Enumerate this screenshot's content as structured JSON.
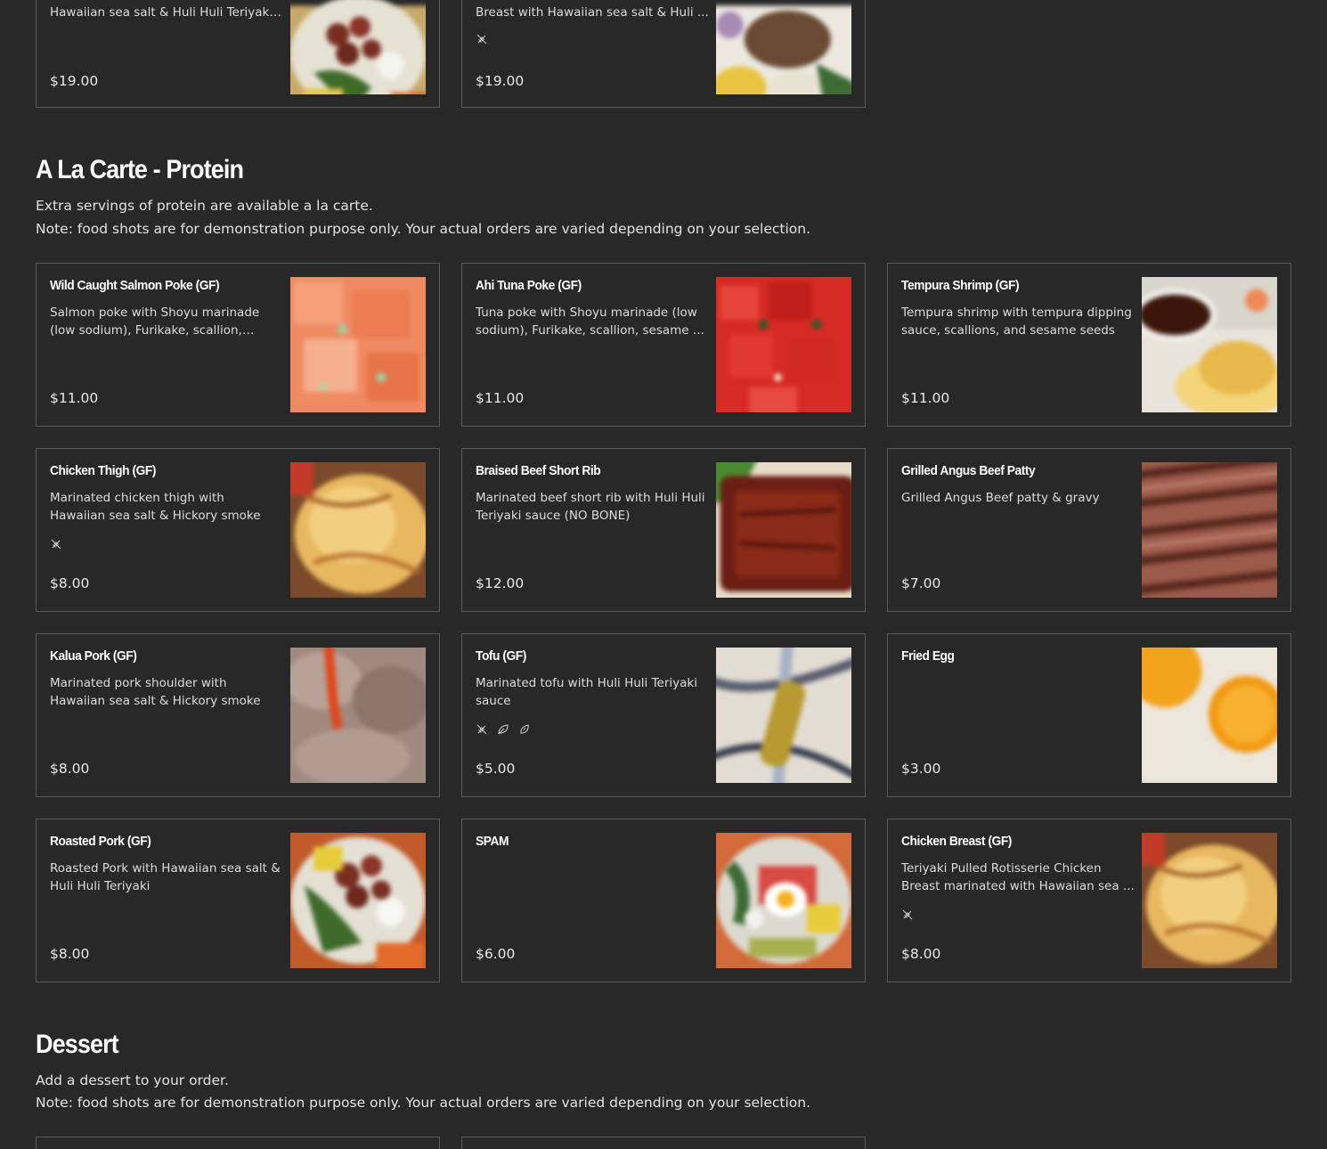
{
  "top_items": [
    {
      "desc": "Hawaiian sea salt & Huli Huli Teriyaki ...",
      "price": "$19.00",
      "tags": [],
      "photo": "poke-bowl-icon"
    },
    {
      "desc": "Breast with Hawaiian sea salt & Huli ...",
      "price": "$19.00",
      "tags": [
        "gluten-free-icon"
      ],
      "photo": "chicken-bowl-icon"
    }
  ],
  "a_la_carte": {
    "title": "A La Carte - Protein",
    "desc_line1": "Extra servings of protein are available a la carte.",
    "desc_line2": "Note: food shots are for demonstration purpose only. Your actual orders are varied depending on your selection.",
    "items": [
      {
        "name": "Wild Caught Salmon Poke (GF)",
        "desc": "Salmon poke with Shoyu marinade (low sodium), Furikake, scallion, sesame ...",
        "price": "$11.00",
        "tags": []
      },
      {
        "name": "Ahi Tuna Poke (GF)",
        "desc": "Tuna poke with Shoyu marinade (low sodium), Furikake, scallion, sesame ...",
        "price": "$11.00",
        "tags": []
      },
      {
        "name": "Tempura Shrimp (GF)",
        "desc": "Tempura shrimp with tempura dipping sauce, scallions, and sesame seeds",
        "price": "$11.00",
        "tags": []
      },
      {
        "name": "Chicken Thigh (GF)",
        "desc": "Marinated chicken thigh with Hawaiian sea salt & Hickory smoke",
        "price": "$8.00",
        "tags": [
          "gluten-free-icon"
        ]
      },
      {
        "name": "Braised Beef Short Rib",
        "desc": "Marinated beef short rib with Huli Huli Teriyaki sauce (NO BONE)",
        "price": "$12.00",
        "tags": []
      },
      {
        "name": "Grilled Angus Beef Patty",
        "desc": "Grilled Angus Beef patty & gravy",
        "price": "$7.00",
        "tags": []
      },
      {
        "name": "Kalua Pork (GF)",
        "desc": "Marinated pork shoulder with Hawaiian sea salt & Hickory smoke",
        "price": "$8.00",
        "tags": []
      },
      {
        "name": "Tofu (GF)",
        "desc": "Marinated tofu with Huli Huli Teriyaki sauce",
        "price": "$5.00",
        "tags": [
          "gluten-free-icon",
          "vegetarian-leaf-icon",
          "vegan-leaf-icon"
        ]
      },
      {
        "name": "Fried Egg",
        "desc": "",
        "price": "$3.00",
        "tags": []
      },
      {
        "name": "Roasted Pork (GF)",
        "desc": "Roasted Pork with Hawaiian sea salt & Huli Huli Teriyaki",
        "price": "$8.00",
        "tags": []
      },
      {
        "name": "SPAM",
        "desc": "",
        "price": "$6.00",
        "tags": []
      },
      {
        "name": "Chicken Breast (GF)",
        "desc": "Teriyaki Pulled Rotisserie Chicken Breast marinated with Hawaiian sea ...",
        "price": "$8.00",
        "tags": [
          "gluten-free-icon"
        ]
      }
    ]
  },
  "dessert": {
    "title": "Dessert",
    "desc_line1": "Add a dessert to your order.",
    "desc_line2": "Note: food shots are for demonstration purpose only. Your actual orders are varied depending on your selection."
  },
  "colors": {
    "background": "#282828",
    "card_border": "#5a5a5a",
    "text": "#e6e6e6"
  }
}
